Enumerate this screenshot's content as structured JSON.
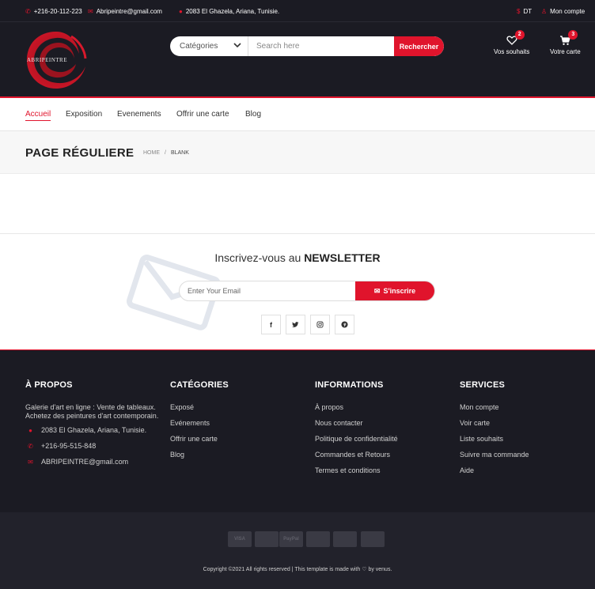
{
  "topbar": {
    "phone": "+216-20-112-223",
    "email": "Abripeintre@gmail.com",
    "address": "2083 El Ghazela, Ariana, Tunisie.",
    "currency": "DT",
    "account": "Mon compte"
  },
  "header": {
    "logo_text": "ABRIPEINTRE",
    "category_select": "Catégories",
    "search_placeholder": "Search here",
    "search_button": "Rechercher",
    "wishlist_label": "Vos souhaits",
    "wishlist_count": "2",
    "cart_label": "Votre carte",
    "cart_count": "3"
  },
  "nav": {
    "items": [
      "Accueil",
      "Exposition",
      "Evenements",
      "Offrir une carte",
      "Blog"
    ]
  },
  "page": {
    "title": "PAGE RÉGULIERE",
    "breadcrumb_home": "HOME",
    "breadcrumb_sep": "/",
    "breadcrumb_current": "BLANK"
  },
  "newsletter": {
    "title_prefix": "Inscrivez-vous au",
    "title_strong": "NEWSLETTER",
    "email_placeholder": "Enter Your Email",
    "subscribe_button": "S'inscrire"
  },
  "footer": {
    "about": {
      "heading": "À PROPOS",
      "text": "Galerie d'art en ligne : Vente de tableaux. Achetez des peintures d'art contemporain.",
      "address": "2083 El Ghazela, Ariana, Tunisie.",
      "phone": "+216-95-515-848",
      "email": "ABRIPEINTRE@gmail.com"
    },
    "categories": {
      "heading": "CATÉGORIES",
      "links": [
        "Exposé",
        "Evénements",
        "Offrir une carte",
        "Blog"
      ]
    },
    "informations": {
      "heading": "INFORMATIONS",
      "links": [
        "À propos",
        "Nous contacter",
        "Politique de confidentialité",
        "Commandes et Retours",
        "Termes et conditions"
      ]
    },
    "services": {
      "heading": "SERVICES",
      "links": [
        "Mon compte",
        "Voir carte",
        "Liste souhaits",
        "Suivre ma commande",
        "Aide"
      ]
    }
  },
  "bottom": {
    "payments": [
      "VISA",
      "",
      "PayPal",
      "",
      "",
      ""
    ],
    "copyright_prefix": "Copyright ©2021 All rights reserved | This template is made with",
    "copyright_suffix": "by venus."
  },
  "colors": {
    "accent": "#e0142c",
    "dark": "#1b1b23"
  }
}
